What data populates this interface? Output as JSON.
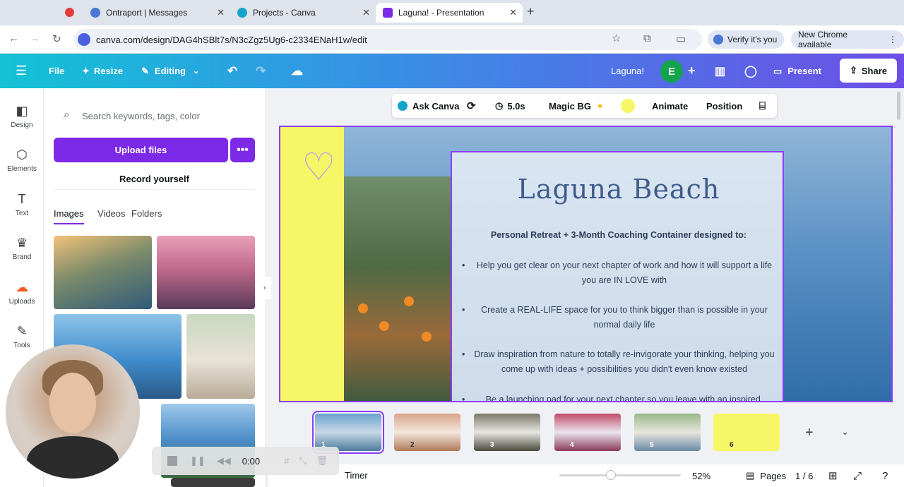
{
  "browser": {
    "tabs": [
      {
        "label": "Ontraport | Messages",
        "favicon_color": "#4678d4"
      },
      {
        "label": "Projects - Canva",
        "favicon_color": "#13a5c9"
      },
      {
        "label": "Laguna! - Presentation",
        "favicon_color": "#7d2ae8"
      }
    ],
    "url": "canva.com/design/DAG4hSBlt7s/N3cZgz5Ug6-c2334ENaH1w/edit",
    "verify_label": "Verify it's you",
    "update_label": "New Chrome available"
  },
  "header": {
    "file_label": "File",
    "resize_label": "Resize",
    "editing_label": "Editing",
    "title": "Laguna!",
    "avatar_initial": "E",
    "present_label": "Present",
    "share_label": "Share"
  },
  "rail": {
    "items": [
      {
        "label": "Design",
        "icon": "design-icon"
      },
      {
        "label": "Elements",
        "icon": "elements-icon"
      },
      {
        "label": "Text",
        "icon": "text-icon"
      },
      {
        "label": "Brand",
        "icon": "brand-icon"
      },
      {
        "label": "Uploads",
        "icon": "uploads-icon"
      },
      {
        "label": "Tools",
        "icon": "tools-icon"
      }
    ]
  },
  "panel": {
    "search_placeholder": "Search keywords, tags, color",
    "upload_label": "Upload files",
    "record_label": "Record yourself",
    "tabs": [
      "Images",
      "Videos",
      "Folders"
    ]
  },
  "toolbar": {
    "ask_label": "Ask Canva",
    "duration": "5.0s",
    "magic_bg": "Magic BG",
    "animate": "Animate",
    "position": "Position"
  },
  "slide": {
    "title": "Laguna Beach",
    "subtitle": "Personal Retreat  + 3-Month Coaching Container designed to:",
    "bullets": [
      "Help you get clear on your next chapter of work and how it will support a life you are IN LOVE with",
      "Create a REAL-LIFE space for you to think bigger than is possible in your normal daily life",
      "Draw inspiration from nature to totally re-invigorate your thinking, helping you come up with ideas + possibilities you didn't even know existed",
      "Be a launching pad for your next chapter so you leave with an inspired,"
    ]
  },
  "pages": {
    "numbers": [
      "1",
      "2",
      "3",
      "4",
      "5",
      "6"
    ],
    "zoom": "52%",
    "pages_label": "Pages",
    "page_count": "1 / 6"
  },
  "recorder": {
    "time": "0:00",
    "timer_label": "Timer"
  }
}
